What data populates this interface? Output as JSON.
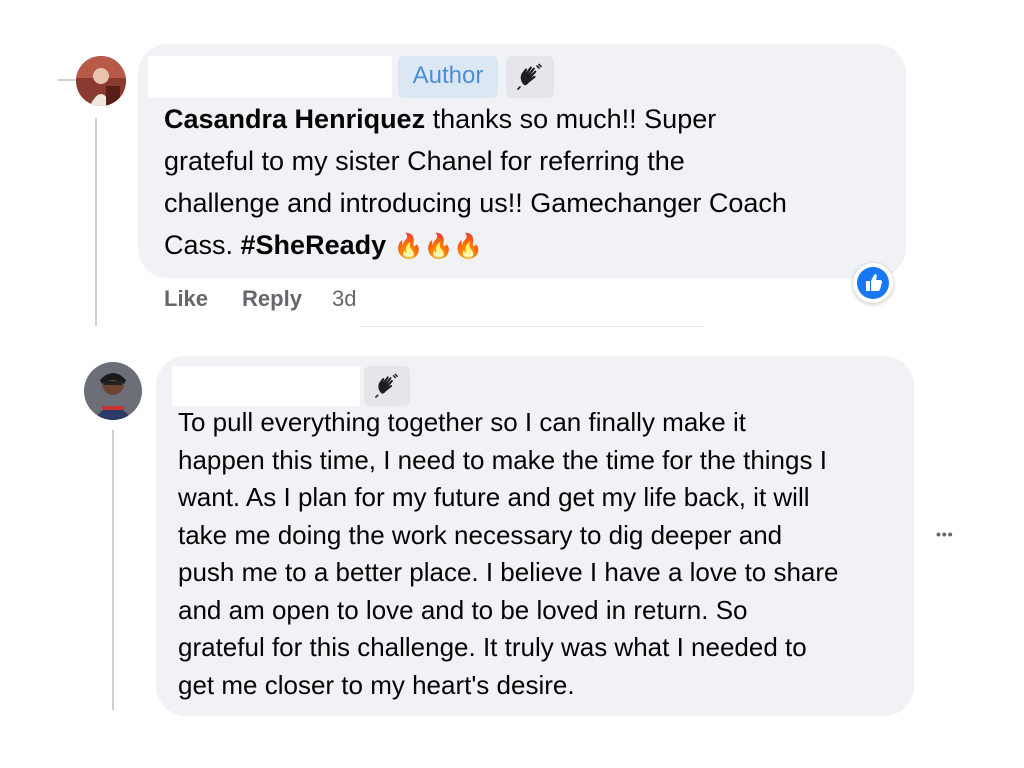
{
  "comment1": {
    "author_badge": "Author",
    "badge_icon": "waving-hand-icon",
    "author_name": "Casandra Henriquez",
    "body_lines": [
      " thanks so much!! Super",
      "grateful to my sister Chanel for referring the",
      "challenge and introducing us!! Gamechanger Coach",
      "Cass. "
    ],
    "hashtag": "#SheReady",
    "emoji": "🔥🔥🔥",
    "actions": {
      "like": "Like",
      "reply": "Reply",
      "time": "3d"
    },
    "reaction_icon": "like-reaction-icon"
  },
  "comment2": {
    "badge_icon": "waving-hand-icon",
    "body_lines": [
      "To pull everything together so I can finally make it",
      "happen this time, I need to make the time for the things I",
      "want. As I plan for my future and get my life back, it will",
      "take me doing the work necessary to dig deeper and",
      "push me to a better place. I believe I have a love to share",
      "and am open to love and to be loved in return. So",
      "grateful for this challenge. It truly was what I needed to",
      "get me closer to my heart's desire."
    ],
    "more_label": "•••"
  },
  "colors": {
    "bubble": "#f0f2f5",
    "author_badge_bg": "#dbe7f2",
    "author_badge_text": "#4a8fd6",
    "like_blue": "#1877f2"
  }
}
